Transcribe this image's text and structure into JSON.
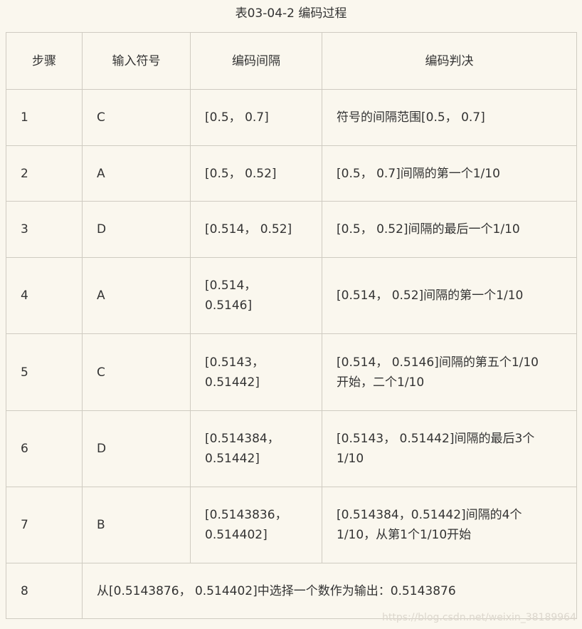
{
  "caption": "表03-04-2 编码过程",
  "headers": [
    "步骤",
    "输入符号",
    "编码间隔",
    "编码判决"
  ],
  "rows": [
    {
      "step": "1",
      "symbol": "C",
      "interval": [
        "[0.5， 0.7]"
      ],
      "decision": [
        "符号的间隔范围[0.5， 0.7]"
      ]
    },
    {
      "step": "2",
      "symbol": "A",
      "interval": [
        "[0.5， 0.52]"
      ],
      "decision": [
        "[0.5， 0.7]间隔的第一个1/10"
      ]
    },
    {
      "step": "3",
      "symbol": "D",
      "interval": [
        "[0.514， 0.52]"
      ],
      "decision": [
        "[0.5， 0.52]间隔的最后一个1/10"
      ]
    },
    {
      "step": "4",
      "symbol": "A",
      "interval": [
        "[0.514，",
        "0.5146]"
      ],
      "decision": [
        "[0.514， 0.52]间隔的第一个1/10"
      ]
    },
    {
      "step": "5",
      "symbol": "C",
      "interval": [
        "[0.5143，",
        "0.51442]"
      ],
      "decision": [
        "[0.514， 0.5146]间隔的第五个1/10",
        "开始，二个1/10"
      ]
    },
    {
      "step": "6",
      "symbol": "D",
      "interval": [
        "[0.514384，",
        "0.51442]"
      ],
      "decision": [
        "[0.5143， 0.51442]间隔的最后3个",
        "1/10"
      ]
    },
    {
      "step": "7",
      "symbol": "B",
      "interval": [
        "[0.5143836，",
        "0.514402]"
      ],
      "decision": [
        "[0.514384，0.51442]间隔的4个",
        "1/10，从第1个1/10开始"
      ]
    }
  ],
  "final_row": {
    "step": "8",
    "text": "从[0.5143876， 0.514402]中选择一个数作为输出：0.5143876"
  },
  "watermark": "https://blog.csdn.net/weixin_38189964"
}
